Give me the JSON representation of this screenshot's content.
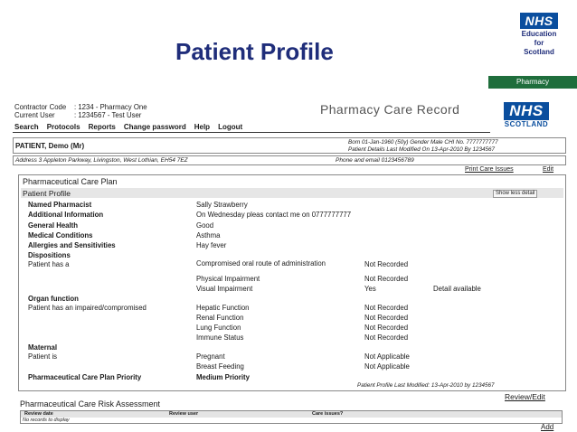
{
  "slide": {
    "title": "Patient Profile",
    "logo": {
      "nhs": "NHS",
      "line1": "Education",
      "line2": "for",
      "line3": "Scotland"
    },
    "pharmacy_tag": "Pharmacy"
  },
  "app": {
    "contractor_label": "Contractor Code",
    "contractor_value": ": 1234 - Pharmacy One",
    "user_label": "Current User",
    "user_value": ": 1234567 - Test User",
    "title": "Pharmacy Care Record",
    "logo": {
      "nhs": "NHS",
      "scotland": "SCOTLAND"
    },
    "menu": [
      "Search",
      "Protocols",
      "Reports",
      "Change password",
      "Help",
      "Logout"
    ]
  },
  "patient": {
    "name": "PATIENT, Demo (Mr)",
    "meta_line1": "Born 01-Jan-1960 (50y) Gender Male CHI No. 7777777777",
    "meta_line2": "Patient Details Last Modified On 13-Apr-2010 By 1234567",
    "address": "Address 3 Appleton Parkway, Livingston, West Lothian, EH54 7EZ",
    "phone": "Phone and email 0123456789"
  },
  "links": {
    "print": "Print Care Issues",
    "edit": "Edit",
    "review_edit": "Review/Edit",
    "add": "Add"
  },
  "care_plan": {
    "title": "Pharmaceutical Care Plan",
    "profile_label": "Patient Profile",
    "show_less": "Show less detail",
    "named_pharmacist_label": "Named Pharmacist",
    "named_pharmacist": "Sally Strawberry",
    "additional_label": "Additional Information",
    "additional": "On Wednesday pleas contact me on 0777777777",
    "general_health_label": "General Health",
    "general_health": "Good",
    "medical_label": "Medical Conditions",
    "medical": "Asthma",
    "allergies_label": "Allergies and Sensitivities",
    "allergies": "Hay fever",
    "dispositions_label": "Dispositions",
    "patient_has_a": "Patient has a",
    "dispositions": [
      {
        "item": "Compromised oral route of administration",
        "status": "Not Recorded",
        "detail": ""
      },
      {
        "item": "Physical Impairment",
        "status": "Not Recorded",
        "detail": ""
      },
      {
        "item": "Visual Impairment",
        "status": "Yes",
        "detail": "Detail available"
      }
    ],
    "organ_label": "Organ function",
    "organ_sub": "Patient has an impaired/compromised",
    "organ": [
      {
        "item": "Hepatic Function",
        "status": "Not Recorded"
      },
      {
        "item": "Renal Function",
        "status": "Not Recorded"
      },
      {
        "item": "Lung Function",
        "status": "Not Recorded"
      },
      {
        "item": "Immune Status",
        "status": "Not Recorded"
      }
    ],
    "maternal_label": "Maternal",
    "patient_is": "Patient is",
    "maternal": [
      {
        "item": "Pregnant",
        "status": "Not Applicable"
      },
      {
        "item": "Breast Feeding",
        "status": "Not Applicable"
      }
    ],
    "priority_label": "Pharmaceutical Care Plan Priority",
    "priority": "Medium Priority",
    "modified": "Patient Profile Last Modified: 13-Apr-2010 by 1234567"
  },
  "risk": {
    "title": "Pharmaceutical Care Risk Assessment",
    "columns": [
      "Review date",
      "Review user",
      "Care issues?"
    ],
    "empty": "No records to display"
  }
}
